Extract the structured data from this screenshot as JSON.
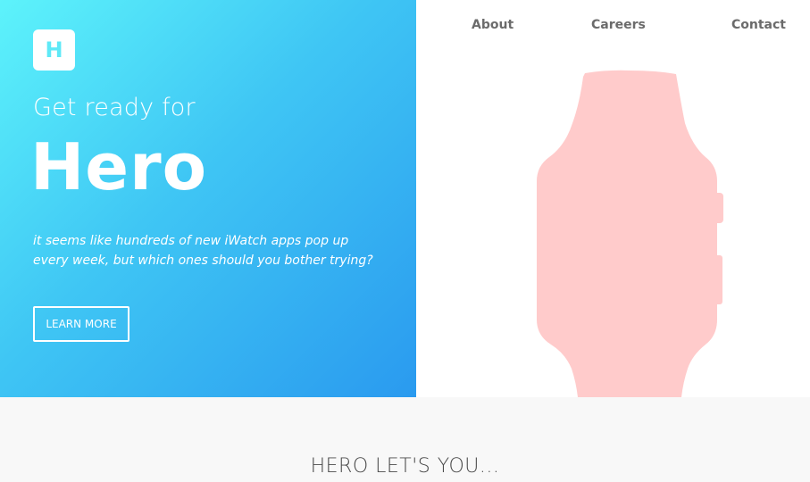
{
  "colors": {
    "gradient_start": "#5df3fb",
    "gradient_end": "#2a9aef",
    "watch": "#ffcbcb",
    "section_bg": "#f8f8f8"
  },
  "logo": {
    "letter": "H"
  },
  "nav": {
    "items": [
      {
        "label": "About"
      },
      {
        "label": "Careers"
      },
      {
        "label": "Contact"
      }
    ]
  },
  "hero": {
    "kicker": "Get ready for",
    "headline": "Hero",
    "tagline": "it seems like hundreds of new iWatch apps pop up every week, but which ones should you bother trying?",
    "cta_label": "LEARN MORE",
    "illustration_icon": "smartwatch-icon"
  },
  "features": {
    "title": "HERO LET'S YOU..."
  }
}
